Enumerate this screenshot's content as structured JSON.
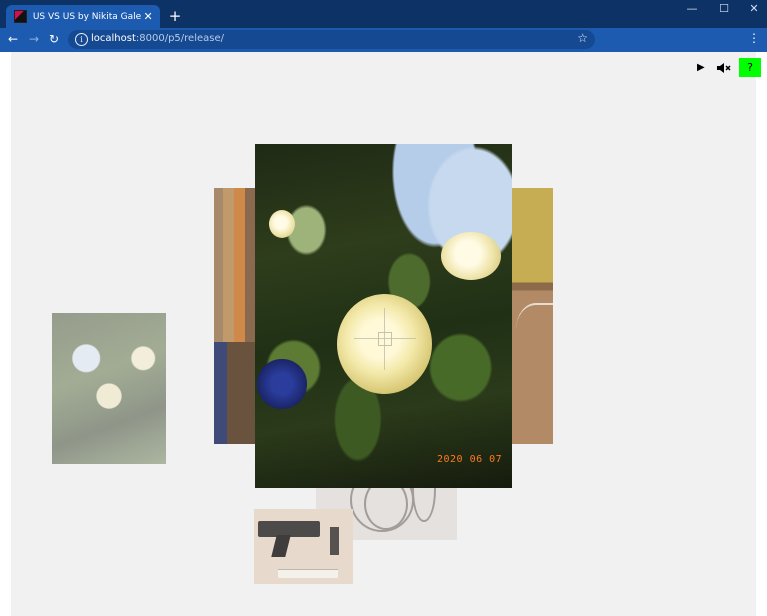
{
  "browser": {
    "tab_title": "US VS US by Nikita Gale",
    "tab_close": "✕",
    "new_tab": "+",
    "window_controls": {
      "minimize": "—",
      "maximize": "☐",
      "close": "✕"
    },
    "nav": {
      "back": "←",
      "forward": "→",
      "reload": "↻"
    },
    "url_host": "localhost",
    "url_path": ":8000/p5/release/",
    "info_icon": "i",
    "star_icon": "☆",
    "menu_icon": "⋮"
  },
  "page": {
    "controls": {
      "play_icon": "▶",
      "mute_icon": "speaker-muted-icon",
      "help_label": "?",
      "help_color": "#00ff00"
    },
    "photo_date_stamp": "2020 06 07"
  }
}
